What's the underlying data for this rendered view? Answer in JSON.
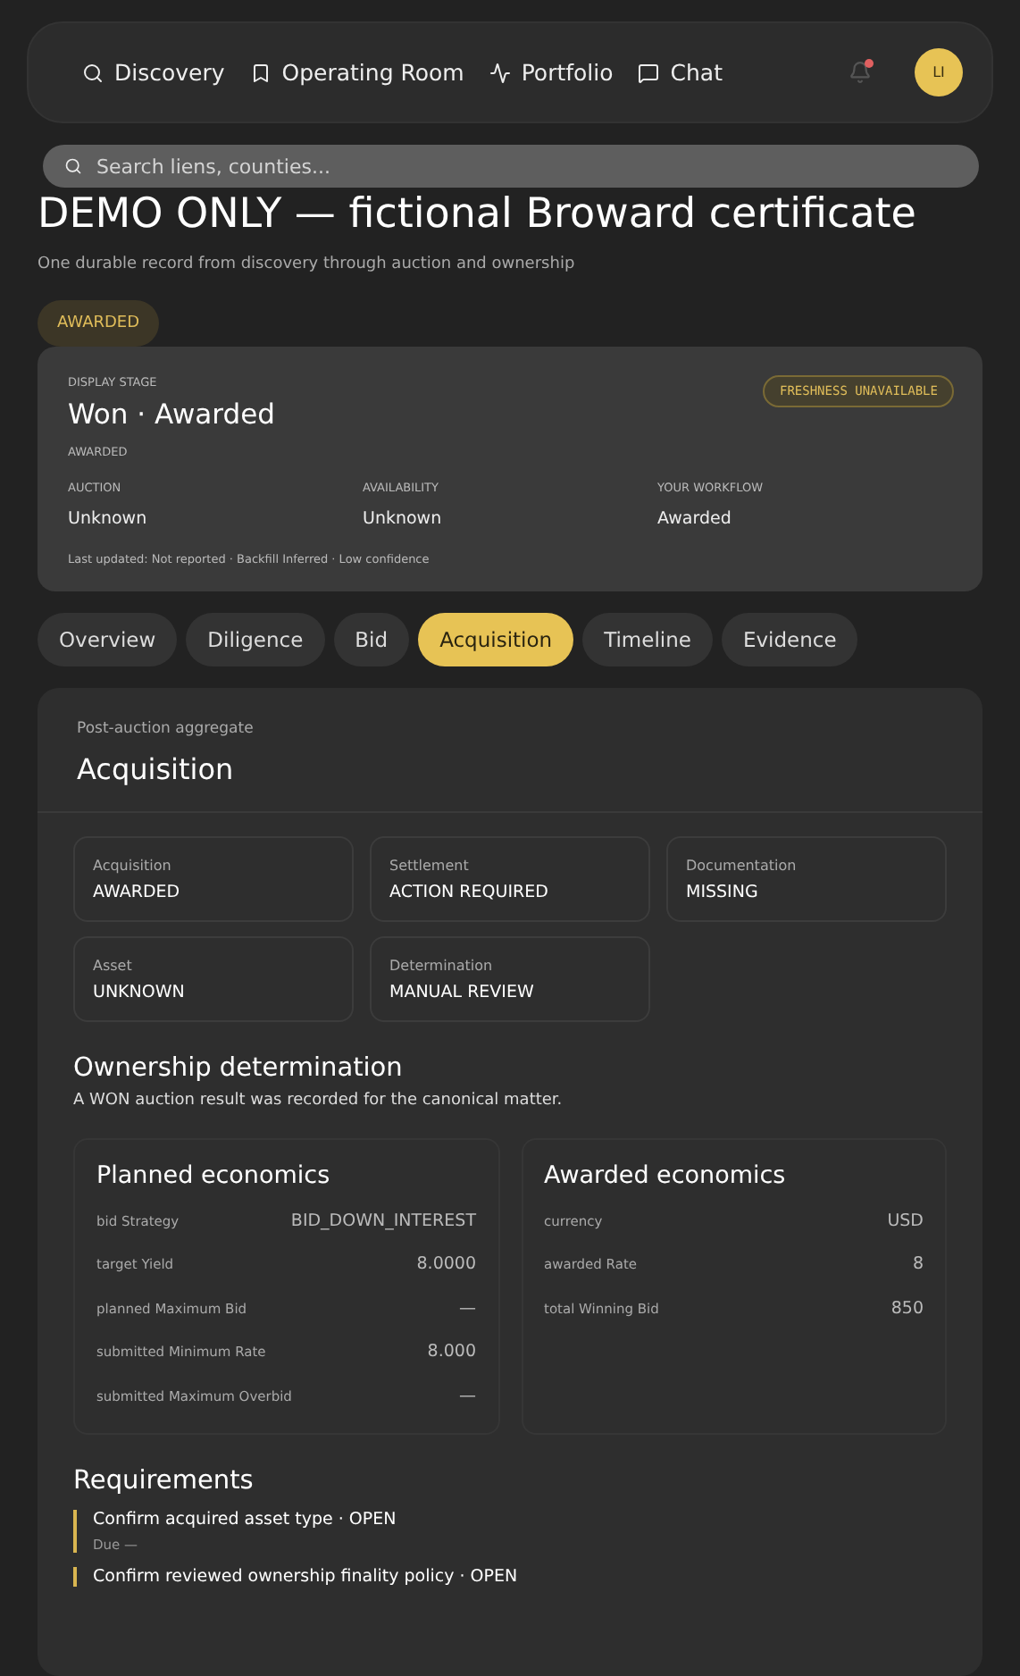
{
  "nav": {
    "items": [
      {
        "label": "Discovery",
        "selected": false
      },
      {
        "label": "Operating Room",
        "selected": false
      },
      {
        "label": "Portfolio",
        "selected": false
      },
      {
        "label": "Chat",
        "selected": false
      }
    ],
    "notification_unread": true,
    "avatar": "LI"
  },
  "search": {
    "placeholder": "Search liens, counties..."
  },
  "title": "DEMO ONLY — fictional Broward certificate",
  "subtitle": "One durable record from discovery through auction and ownership",
  "status_badge": "AWARDED",
  "stage_card": {
    "label": "DISPLAY STAGE",
    "stage": "Won · Awarded",
    "sub": "AWARDED",
    "freshness": "FRESHNESS UNAVAILABLE",
    "fields": [
      {
        "label": "AUCTION",
        "value": "Unknown"
      },
      {
        "label": "AVAILABILITY",
        "value": "Unknown"
      },
      {
        "label": "YOUR WORKFLOW",
        "value": "Awarded"
      }
    ],
    "footnote": "Last updated: Not reported · Backfill Inferred · Low confidence"
  },
  "tabs": [
    {
      "label": "Overview",
      "selected": false
    },
    {
      "label": "Diligence",
      "selected": false
    },
    {
      "label": "Bid",
      "selected": false
    },
    {
      "label": "Acquisition",
      "selected": true
    },
    {
      "label": "Timeline",
      "selected": false
    },
    {
      "label": "Evidence",
      "selected": false
    }
  ],
  "panel": {
    "eyebrow": "Post-auction aggregate",
    "title": "Acquisition",
    "statuses": [
      {
        "label": "Acquisition",
        "value": "AWARDED"
      },
      {
        "label": "Settlement",
        "value": "ACTION REQUIRED"
      },
      {
        "label": "Documentation",
        "value": "MISSING"
      },
      {
        "label": "Asset",
        "value": "UNKNOWN"
      },
      {
        "label": "Determination",
        "value": "MANUAL REVIEW"
      }
    ],
    "ownership": {
      "title": "Ownership determination",
      "text": "A WON auction result was recorded for the canonical matter."
    },
    "economics": [
      {
        "title": "Planned economics",
        "rows": [
          {
            "label": "bid Strategy",
            "value": "BID_DOWN_INTEREST"
          },
          {
            "label": "target Yield",
            "value": "8.0000"
          },
          {
            "label": "planned Maximum Bid",
            "value": "—"
          },
          {
            "label": "submitted Minimum Rate",
            "value": "8.000"
          },
          {
            "label": "submitted Maximum Overbid",
            "value": "—"
          }
        ]
      },
      {
        "title": "Awarded economics",
        "rows": [
          {
            "label": "currency",
            "value": "USD"
          },
          {
            "label": "awarded Rate",
            "value": "8"
          },
          {
            "label": "total Winning Bid",
            "value": "850"
          }
        ]
      }
    ],
    "requirements": {
      "title": "Requirements",
      "items": [
        {
          "text": "Confirm acquired asset type · OPEN",
          "due": "Due —"
        },
        {
          "text": "Confirm reviewed ownership finality policy · OPEN"
        }
      ]
    }
  }
}
